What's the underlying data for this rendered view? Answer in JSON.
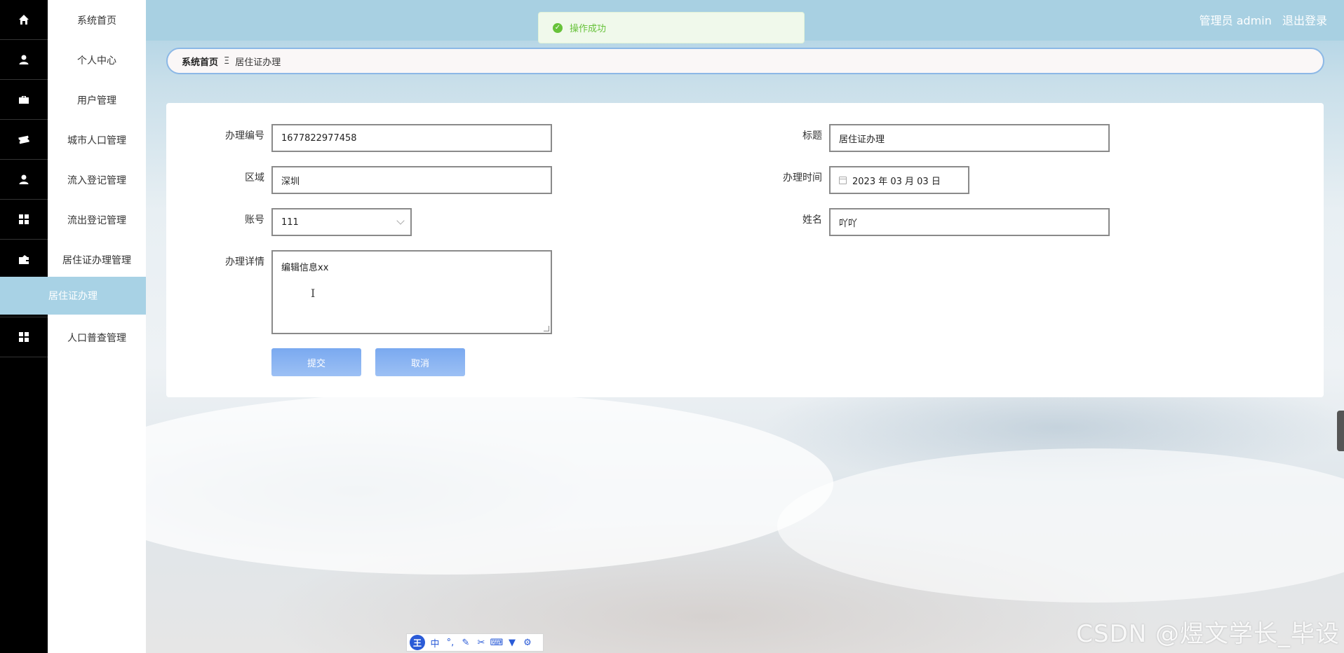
{
  "sidebar": {
    "items": [
      {
        "label": "系统首页",
        "icon": "home-icon"
      },
      {
        "label": "个人中心",
        "icon": "user-icon"
      },
      {
        "label": "用户管理",
        "icon": "briefcase-icon"
      },
      {
        "label": "城市人口管理",
        "icon": "ticket-icon"
      },
      {
        "label": "流入登记管理",
        "icon": "user-icon"
      },
      {
        "label": "流出登记管理",
        "icon": "grid-icon"
      },
      {
        "label": "居住证办理管理",
        "icon": "wallet-icon"
      },
      {
        "label": "人口普查管理",
        "icon": "grid-icon"
      }
    ],
    "active_sub": "居住证办理"
  },
  "header": {
    "user_label": "管理员 admin",
    "logout_label": "退出登录"
  },
  "toast": {
    "message": "操作成功"
  },
  "breadcrumb": {
    "home": "系统首页",
    "separator": "Ξ",
    "current": "居住证办理"
  },
  "form": {
    "bianhao": {
      "label": "办理编号",
      "value": "1677822977458"
    },
    "biaoti": {
      "label": "标题",
      "value": "居住证办理"
    },
    "quyu": {
      "label": "区域",
      "value": "深圳"
    },
    "shijian": {
      "label": "办理时间",
      "value": "2023 年 03 月 03 日"
    },
    "zhanghao": {
      "label": "账号",
      "value": "111"
    },
    "xingming": {
      "label": "姓名",
      "value": "吖吖"
    },
    "xiangqing": {
      "label": "办理详情",
      "value": "编辑信息xx"
    }
  },
  "buttons": {
    "submit": "提交",
    "cancel": "取消"
  },
  "ime": {
    "logo": "王",
    "mode": "中"
  },
  "watermark": "CSDN @煜文学长_毕设",
  "colors": {
    "header": "#a8d0e2",
    "active_menu": "#a8d2e5",
    "button": "#8ab4f2",
    "toast_text": "#67c23a"
  }
}
